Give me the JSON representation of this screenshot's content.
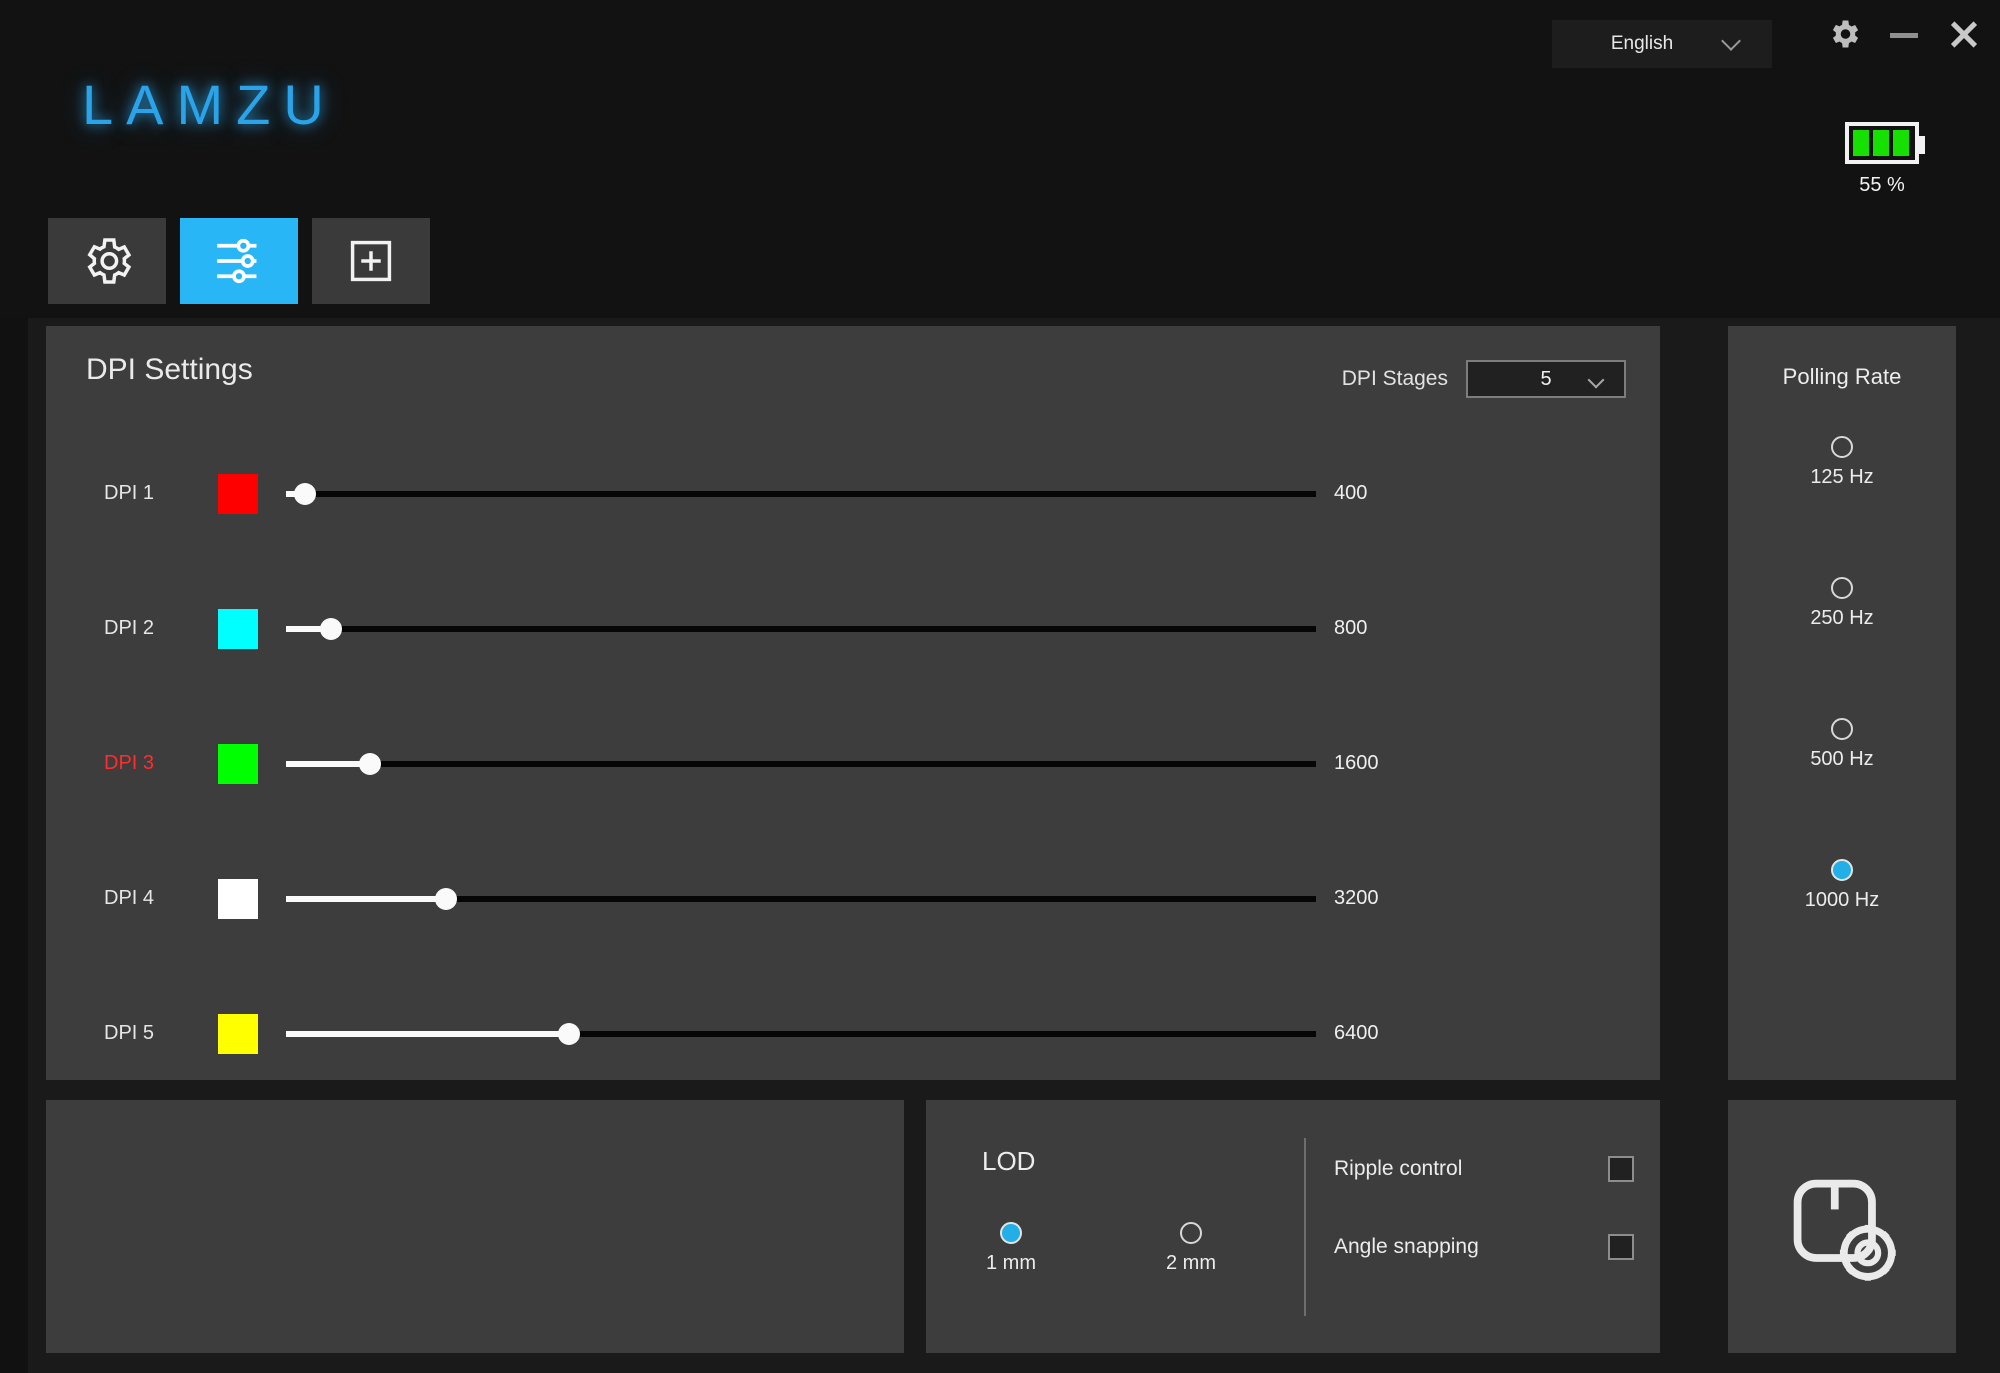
{
  "header": {
    "logo_text": "LAMZU",
    "language": {
      "selected": "English",
      "chevron_icon": "chevron-down-icon"
    },
    "window_controls": {
      "settings_icon": "gear-icon",
      "minimize_icon": "minimize-icon",
      "close_icon": "close-icon"
    },
    "battery": {
      "percent_text": "55 %",
      "level_bars": 3,
      "color": "#16e000"
    }
  },
  "tabs": [
    {
      "name": "tab-general-settings",
      "icon": "gear-icon",
      "active": false
    },
    {
      "name": "tab-performance",
      "icon": "sliders-icon",
      "active": true
    },
    {
      "name": "tab-add-profile",
      "icon": "plus-square-icon",
      "active": false
    }
  ],
  "dpi_settings": {
    "title": "DPI Settings",
    "stages_label": "DPI Stages",
    "stages_value": "5",
    "stages_chevron_icon": "chevron-down-icon",
    "rows": [
      {
        "label": "DPI 1",
        "color": "#FF0000",
        "value": "400",
        "percent": 1.8,
        "active": false
      },
      {
        "label": "DPI 2",
        "color": "#00FFFF",
        "value": "800",
        "percent": 4.4,
        "active": false
      },
      {
        "label": "DPI 3",
        "color": "#00FF00",
        "value": "1600",
        "percent": 8.2,
        "active": true
      },
      {
        "label": "DPI 4",
        "color": "#FFFFFF",
        "value": "3200",
        "percent": 15.5,
        "active": false
      },
      {
        "label": "DPI 5",
        "color": "#FFFF00",
        "value": "6400",
        "percent": 27.5,
        "active": false
      }
    ]
  },
  "polling_rate": {
    "title": "Polling Rate",
    "options": [
      {
        "label": "125 Hz",
        "selected": false
      },
      {
        "label": "250 Hz",
        "selected": false
      },
      {
        "label": "500 Hz",
        "selected": false
      },
      {
        "label": "1000 Hz",
        "selected": true
      }
    ],
    "selected_color": "#22aee6"
  },
  "lod": {
    "title": "LOD",
    "options": [
      {
        "label": "1 mm",
        "selected": true
      },
      {
        "label": "2 mm",
        "selected": false
      }
    ],
    "checkboxes": [
      {
        "label": "Ripple control",
        "checked": false
      },
      {
        "label": "Angle snapping",
        "checked": false
      }
    ]
  },
  "mouse_panel": {
    "icon": "mouse-settings-icon"
  },
  "theme": {
    "accent": "#29b6f6",
    "panel_bg": "#3d3d3d",
    "app_bg": "#111111",
    "active_dpi_label": "#ff2d2d"
  }
}
